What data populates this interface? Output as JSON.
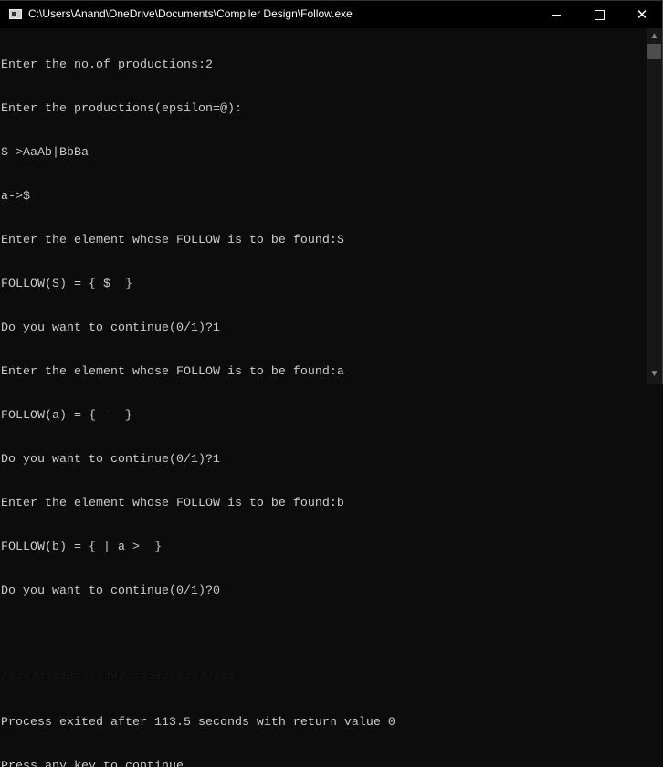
{
  "window": {
    "title": "C:\\Users\\Anand\\OneDrive\\Documents\\Compiler Design\\Follow.exe",
    "icon": "console-app-icon"
  },
  "controls": {
    "minimize": "minimize-icon",
    "maximize": "maximize-icon",
    "close": "close-icon"
  },
  "console": {
    "lines": [
      "Enter the no.of productions:2",
      "Enter the productions(epsilon=@):",
      "S->AaAb|BbBa",
      "a->$",
      "Enter the element whose FOLLOW is to be found:S",
      "FOLLOW(S) = { $  }",
      "Do you want to continue(0/1)?1",
      "Enter the element whose FOLLOW is to be found:a",
      "FOLLOW(a) = { -  }",
      "Do you want to continue(0/1)?1",
      "Enter the element whose FOLLOW is to be found:b",
      "FOLLOW(b) = { | a >  }",
      "Do you want to continue(0/1)?0",
      "",
      "--------------------------------",
      "Process exited after 113.5 seconds with return value 0",
      "Press any key to continue . . ."
    ]
  }
}
